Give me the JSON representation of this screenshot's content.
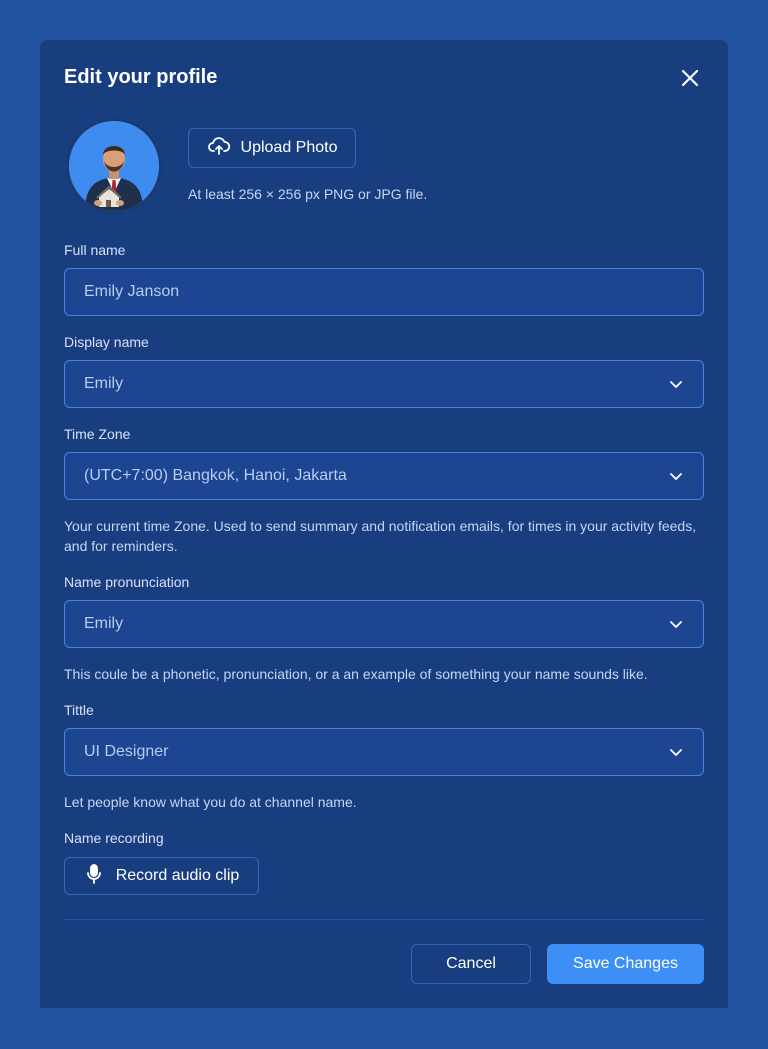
{
  "modal": {
    "title": "Edit your profile"
  },
  "photo": {
    "upload_label": "Upload Photo",
    "hint": "At least 256 × 256 px PNG or JPG file."
  },
  "fields": {
    "full_name": {
      "label": "Full name",
      "value": "Emily Janson"
    },
    "display_name": {
      "label": "Display name",
      "value": "Emily"
    },
    "time_zone": {
      "label": "Time Zone",
      "value": "(UTC+7:00) Bangkok, Hanoi, Jakarta",
      "help": "Your current time Zone. Used to send summary and notification emails, for times in your activity feeds, and for reminders."
    },
    "name_pronunciation": {
      "label": "Name pronunciation",
      "value": "Emily",
      "help": "This coule be a phonetic, pronunciation, or a an example of something your name sounds like."
    },
    "title": {
      "label": "Tittle",
      "value": "UI Designer",
      "help": "Let people know what you do at channel name."
    },
    "name_recording": {
      "label": "Name recording",
      "button_label": "Record audio clip"
    }
  },
  "actions": {
    "cancel_label": "Cancel",
    "save_label": "Save Changes"
  },
  "colors": {
    "background": "#2152a0",
    "modal": "#193e80",
    "field_border": "#4a83e6",
    "primary": "#3d8ef5"
  },
  "icons": [
    "close-icon",
    "cloud-upload-icon",
    "chevron-down-icon",
    "microphone-icon"
  ]
}
